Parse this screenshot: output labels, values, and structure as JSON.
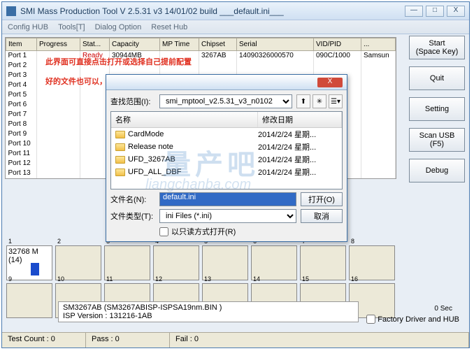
{
  "window": {
    "title": "SMI Mass Production Tool      V 2.5.31  v3      14/01/02 build      ___default.ini___"
  },
  "menu": [
    "Config HUB",
    "Tools[T]",
    "Dialog Option",
    "Reset Hub"
  ],
  "grid": {
    "headers": [
      "Item",
      "Progress",
      "Stat...",
      "Capacity",
      "MP Time",
      "Chipset",
      "Serial",
      "VID/PID",
      "..."
    ],
    "row1": {
      "item": "Port 1",
      "status": "Ready",
      "capacity": "30944MB",
      "chipset": "3267AB",
      "serial": "14090326000570",
      "vidpid": "090C/1000",
      "extra": "Samsun"
    },
    "ports": [
      "Port 2",
      "Port 3",
      "Port 4",
      "Port 5",
      "Port 6",
      "Port 7",
      "Port 8",
      "Port 9",
      "Port 10",
      "Port 11",
      "Port 12",
      "Port 13"
    ]
  },
  "sidebar": [
    {
      "l1": "Start",
      "l2": "(Space Key)"
    },
    {
      "l1": "Quit",
      "l2": ""
    },
    {
      "l1": "Setting",
      "l2": ""
    },
    {
      "l1": "Scan USB",
      "l2": "(F5)"
    },
    {
      "l1": "Debug",
      "l2": ""
    }
  ],
  "overlay": {
    "line1": "此界面可直接点击打开或选择自己提前配置",
    "line2": "好的文件也可以，没有就选择默认的。"
  },
  "dialog": {
    "lookin_label": "查找范围(I):",
    "lookin_value": "smi_mptool_v2.5.31_v3_n0102",
    "col_name": "名称",
    "col_date": "修改日期",
    "files": [
      {
        "name": "CardMode",
        "date": "2014/2/24 星期..."
      },
      {
        "name": "Release note",
        "date": "2014/2/24 星期..."
      },
      {
        "name": "UFD_3267AB",
        "date": "2014/2/24 星期..."
      },
      {
        "name": "UFD_ALL_DBF",
        "date": "2014/2/24 星期..."
      }
    ],
    "filename_label": "文件名(N):",
    "filename_value": "default.ini",
    "filetype_label": "文件类型(T):",
    "filetype_value": "ini Files (*.ini)",
    "open_btn": "打开(O)",
    "cancel_btn": "取消",
    "readonly": "以只读方式打开(R)"
  },
  "slots": {
    "first": {
      "line1": "32768 M",
      "line2": "(14)"
    },
    "nums": [
      "1",
      "2",
      "3",
      "4",
      "5",
      "6",
      "7",
      "8",
      "9",
      "10",
      "11",
      "12",
      "13",
      "14",
      "15",
      "16"
    ]
  },
  "info": {
    "line1": "SM3267AB     (SM3267ABISP-ISPSA19nm.BIN )",
    "line2": "ISP Version :    131216-1AB"
  },
  "sec": "0 Sec",
  "factory": "Factory Driver and HUB",
  "status": {
    "test": "Test Count :  0",
    "pass": "Pass :  0",
    "fail": "Fail :  0"
  },
  "watermark": {
    "big": "量产吧",
    "url": "liangchanba.com"
  }
}
